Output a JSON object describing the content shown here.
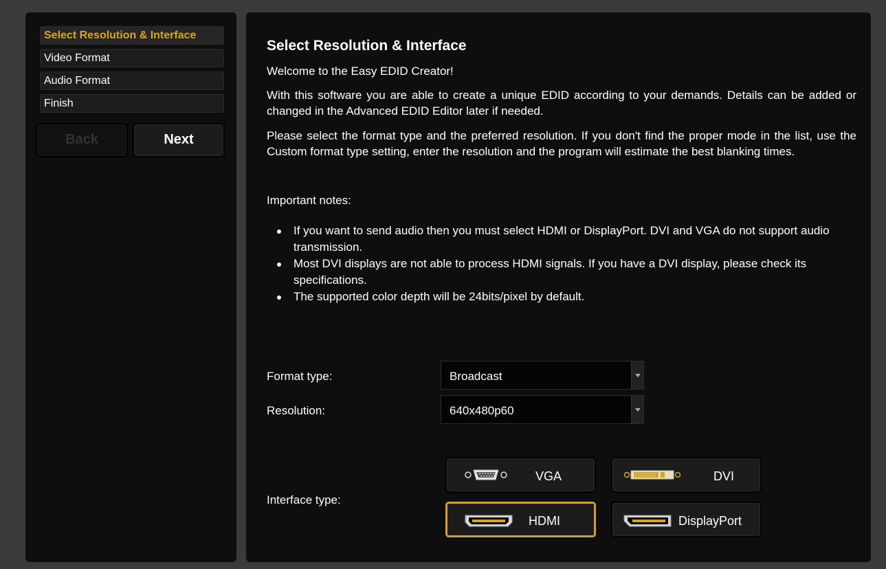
{
  "sidebar": {
    "steps": [
      {
        "label": "Select Resolution & Interface",
        "active": true
      },
      {
        "label": "Video Format",
        "active": false
      },
      {
        "label": "Audio Format",
        "active": false
      },
      {
        "label": "Finish",
        "active": false
      }
    ],
    "back_label": "Back",
    "next_label": "Next"
  },
  "main": {
    "title": "Select Resolution & Interface",
    "welcome": "Welcome to the Easy EDID Creator!",
    "intro": "With this software you are able to create a unique EDID according to your demands. Details can be added or changed in the Advanced EDID Editor later if needed.",
    "instructions": "Please select the format type and the preferred resolution. If you don't find the proper mode in the list, use the Custom format type setting, enter the resolution and the program will estimate the best blanking times.",
    "notes_heading": "Important notes:",
    "notes": [
      "If you want to send audio then you must select HDMI or DisplayPort. DVI and VGA do not support audio transmission.",
      "Most DVI displays are not able to process HDMI signals. If you have a DVI display, please check its specifications.",
      "The supported color depth will be 24bits/pixel by default."
    ],
    "format_type_label": "Format type:",
    "format_type_value": "Broadcast",
    "resolution_label": "Resolution:",
    "resolution_value": "640x480p60",
    "interface_type_label": "Interface type:",
    "interfaces": {
      "vga": "VGA",
      "dvi": "DVI",
      "hdmi": "HDMI",
      "displayport": "DisplayPort"
    },
    "selected_interface": "HDMI"
  },
  "colors": {
    "accent": "#d9a520",
    "background": "#0e0e0e",
    "frame": "#3b3b3b"
  }
}
